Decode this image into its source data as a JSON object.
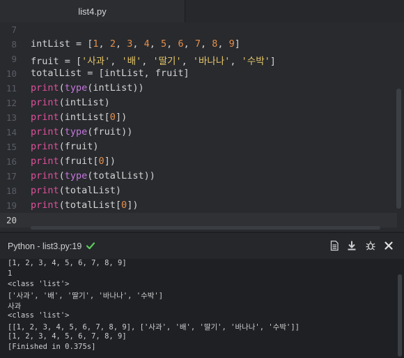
{
  "tab": {
    "title": "list4.py"
  },
  "editor": {
    "lines": [
      {
        "n": "7",
        "tokens": []
      },
      {
        "n": "8",
        "tokens": [
          {
            "t": "intList = [",
            "c": ""
          },
          {
            "t": "1",
            "c": "num"
          },
          {
            "t": ", ",
            "c": ""
          },
          {
            "t": "2",
            "c": "num"
          },
          {
            "t": ", ",
            "c": ""
          },
          {
            "t": "3",
            "c": "num"
          },
          {
            "t": ", ",
            "c": ""
          },
          {
            "t": "4",
            "c": "num"
          },
          {
            "t": ", ",
            "c": ""
          },
          {
            "t": "5",
            "c": "num"
          },
          {
            "t": ", ",
            "c": ""
          },
          {
            "t": "6",
            "c": "num"
          },
          {
            "t": ", ",
            "c": ""
          },
          {
            "t": "7",
            "c": "num"
          },
          {
            "t": ", ",
            "c": ""
          },
          {
            "t": "8",
            "c": "num"
          },
          {
            "t": ", ",
            "c": ""
          },
          {
            "t": "9",
            "c": "num"
          },
          {
            "t": "]",
            "c": ""
          }
        ]
      },
      {
        "n": "9",
        "tokens": [
          {
            "t": "fruit = [",
            "c": ""
          },
          {
            "t": "'사과'",
            "c": "str"
          },
          {
            "t": ", ",
            "c": ""
          },
          {
            "t": "'배'",
            "c": "str"
          },
          {
            "t": ", ",
            "c": ""
          },
          {
            "t": "'딸기'",
            "c": "str"
          },
          {
            "t": ", ",
            "c": ""
          },
          {
            "t": "'바나나'",
            "c": "str"
          },
          {
            "t": ", ",
            "c": ""
          },
          {
            "t": "'수박'",
            "c": "str"
          },
          {
            "t": "]",
            "c": ""
          }
        ]
      },
      {
        "n": "10",
        "tokens": [
          {
            "t": "totalList = [intList, fruit]",
            "c": ""
          }
        ]
      },
      {
        "n": "11",
        "tokens": [
          {
            "t": "print",
            "c": "kw"
          },
          {
            "t": "(",
            "c": ""
          },
          {
            "t": "type",
            "c": "fn"
          },
          {
            "t": "(intList))",
            "c": ""
          }
        ]
      },
      {
        "n": "12",
        "tokens": [
          {
            "t": "print",
            "c": "kw"
          },
          {
            "t": "(intList)",
            "c": ""
          }
        ]
      },
      {
        "n": "13",
        "tokens": [
          {
            "t": "print",
            "c": "kw"
          },
          {
            "t": "(intList[",
            "c": ""
          },
          {
            "t": "0",
            "c": "num"
          },
          {
            "t": "])",
            "c": ""
          }
        ]
      },
      {
        "n": "14",
        "tokens": [
          {
            "t": "print",
            "c": "kw"
          },
          {
            "t": "(",
            "c": ""
          },
          {
            "t": "type",
            "c": "fn"
          },
          {
            "t": "(fruit))",
            "c": ""
          }
        ]
      },
      {
        "n": "15",
        "tokens": [
          {
            "t": "print",
            "c": "kw"
          },
          {
            "t": "(fruit)",
            "c": ""
          }
        ]
      },
      {
        "n": "16",
        "tokens": [
          {
            "t": "print",
            "c": "kw"
          },
          {
            "t": "(fruit[",
            "c": ""
          },
          {
            "t": "0",
            "c": "num"
          },
          {
            "t": "])",
            "c": ""
          }
        ]
      },
      {
        "n": "17",
        "tokens": [
          {
            "t": "print",
            "c": "kw"
          },
          {
            "t": "(",
            "c": ""
          },
          {
            "t": "type",
            "c": "fn"
          },
          {
            "t": "(totalList))",
            "c": ""
          }
        ]
      },
      {
        "n": "18",
        "tokens": [
          {
            "t": "print",
            "c": "kw"
          },
          {
            "t": "(totalList)",
            "c": ""
          }
        ]
      },
      {
        "n": "19",
        "tokens": [
          {
            "t": "print",
            "c": "kw"
          },
          {
            "t": "(totalList[",
            "c": ""
          },
          {
            "t": "0",
            "c": "num"
          },
          {
            "t": "])",
            "c": ""
          }
        ]
      },
      {
        "n": "20",
        "tokens": [],
        "current": true
      }
    ]
  },
  "panel": {
    "title": "Python - list3.py:19",
    "icons": [
      "document-icon",
      "download-icon",
      "bug-icon",
      "close-icon"
    ]
  },
  "console": {
    "lines": [
      "[1, 2, 3, 4, 5, 6, 7, 8, 9]",
      "1",
      "<class 'list'>",
      "['사과', '배', '딸기', '바나나', '수박']",
      "사과",
      "<class 'list'>",
      "[[1, 2, 3, 4, 5, 6, 7, 8, 9], ['사과', '배', '딸기', '바나나', '수박']]",
      "[1, 2, 3, 4, 5, 6, 7, 8, 9]",
      "[Finished in 0.375s]"
    ]
  },
  "colors": {
    "keyword": "#e0509a",
    "function": "#c678dd",
    "number": "#e6904b",
    "string": "#e8c86a",
    "success": "#5ccc5c"
  }
}
